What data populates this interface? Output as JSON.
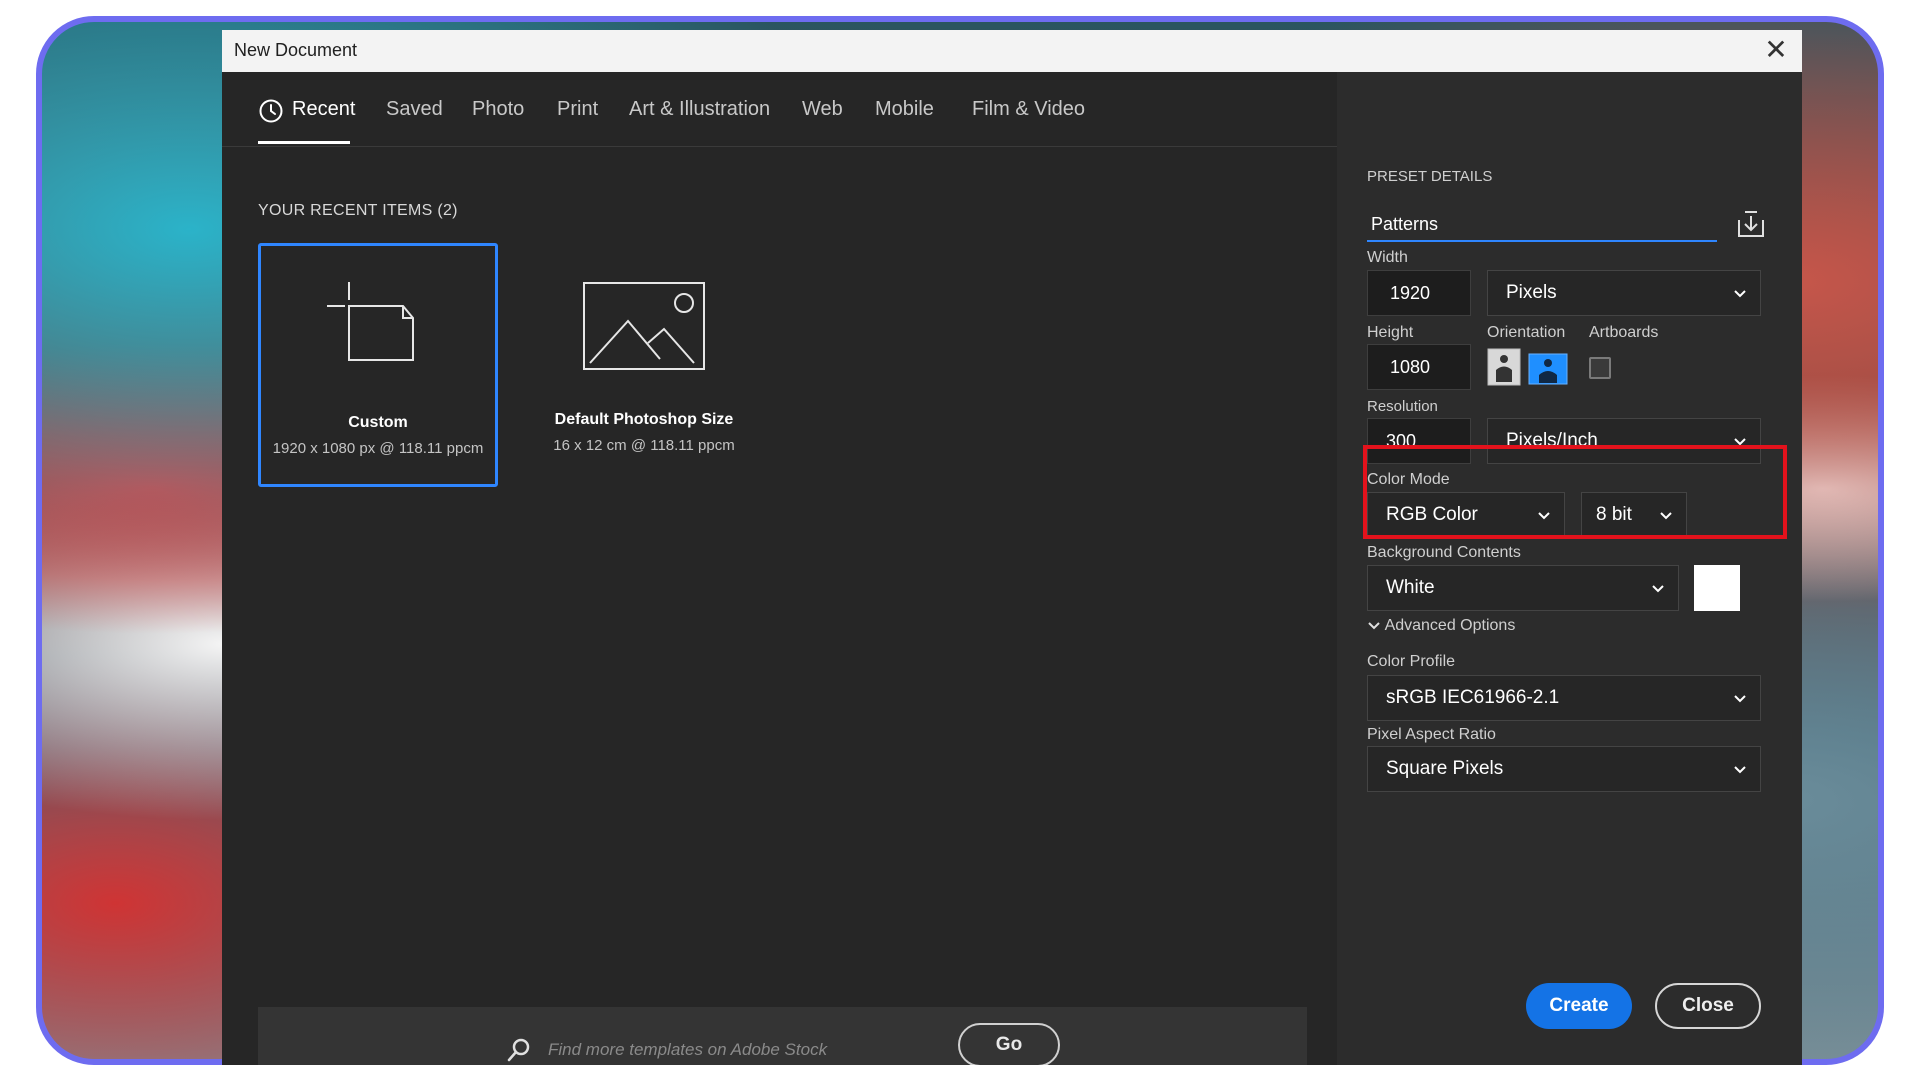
{
  "window": {
    "title": "New Document",
    "close_glyph": "✕"
  },
  "tabs": [
    {
      "label": "Recent",
      "active": true,
      "icon": "clock-icon"
    },
    {
      "label": "Saved"
    },
    {
      "label": "Photo"
    },
    {
      "label": "Print"
    },
    {
      "label": "Art & Illustration"
    },
    {
      "label": "Web"
    },
    {
      "label": "Mobile"
    },
    {
      "label": "Film & Video"
    }
  ],
  "recent": {
    "heading": "YOUR RECENT ITEMS  (2)",
    "items": [
      {
        "name": "Custom",
        "desc": "1920 x 1080 px @ 118.11 ppcm",
        "selected": true,
        "icon": "custom-document-icon"
      },
      {
        "name": "Default Photoshop Size",
        "desc": "16 x 12 cm @ 118.11 ppcm",
        "icon": "image-placeholder-icon"
      }
    ]
  },
  "search": {
    "placeholder": "Find more templates on Adobe Stock",
    "go_label": "Go"
  },
  "preset": {
    "heading": "PRESET DETAILS",
    "name": "Patterns",
    "width_label": "Width",
    "width_value": "1920",
    "width_unit": "Pixels",
    "height_label": "Height",
    "height_value": "1080",
    "orientation_label": "Orientation",
    "orientation_selected": "landscape",
    "artboards_label": "Artboards",
    "artboards_checked": false,
    "resolution_label": "Resolution",
    "resolution_value": "300",
    "resolution_unit": "Pixels/Inch",
    "color_mode_label": "Color Mode",
    "color_mode": "RGB Color",
    "bit_depth": "8 bit",
    "background_label": "Background Contents",
    "background": "White",
    "background_swatch": "#ffffff",
    "advanced_label": "Advanced Options",
    "color_profile_label": "Color Profile",
    "color_profile": "sRGB IEC61966-2.1",
    "pixel_aspect_label": "Pixel Aspect Ratio",
    "pixel_aspect": "Square Pixels"
  },
  "actions": {
    "create": "Create",
    "close": "Close"
  },
  "colors": {
    "accent": "#1473e6",
    "highlight": "#e3121c",
    "frame": "#6e6cf0"
  }
}
